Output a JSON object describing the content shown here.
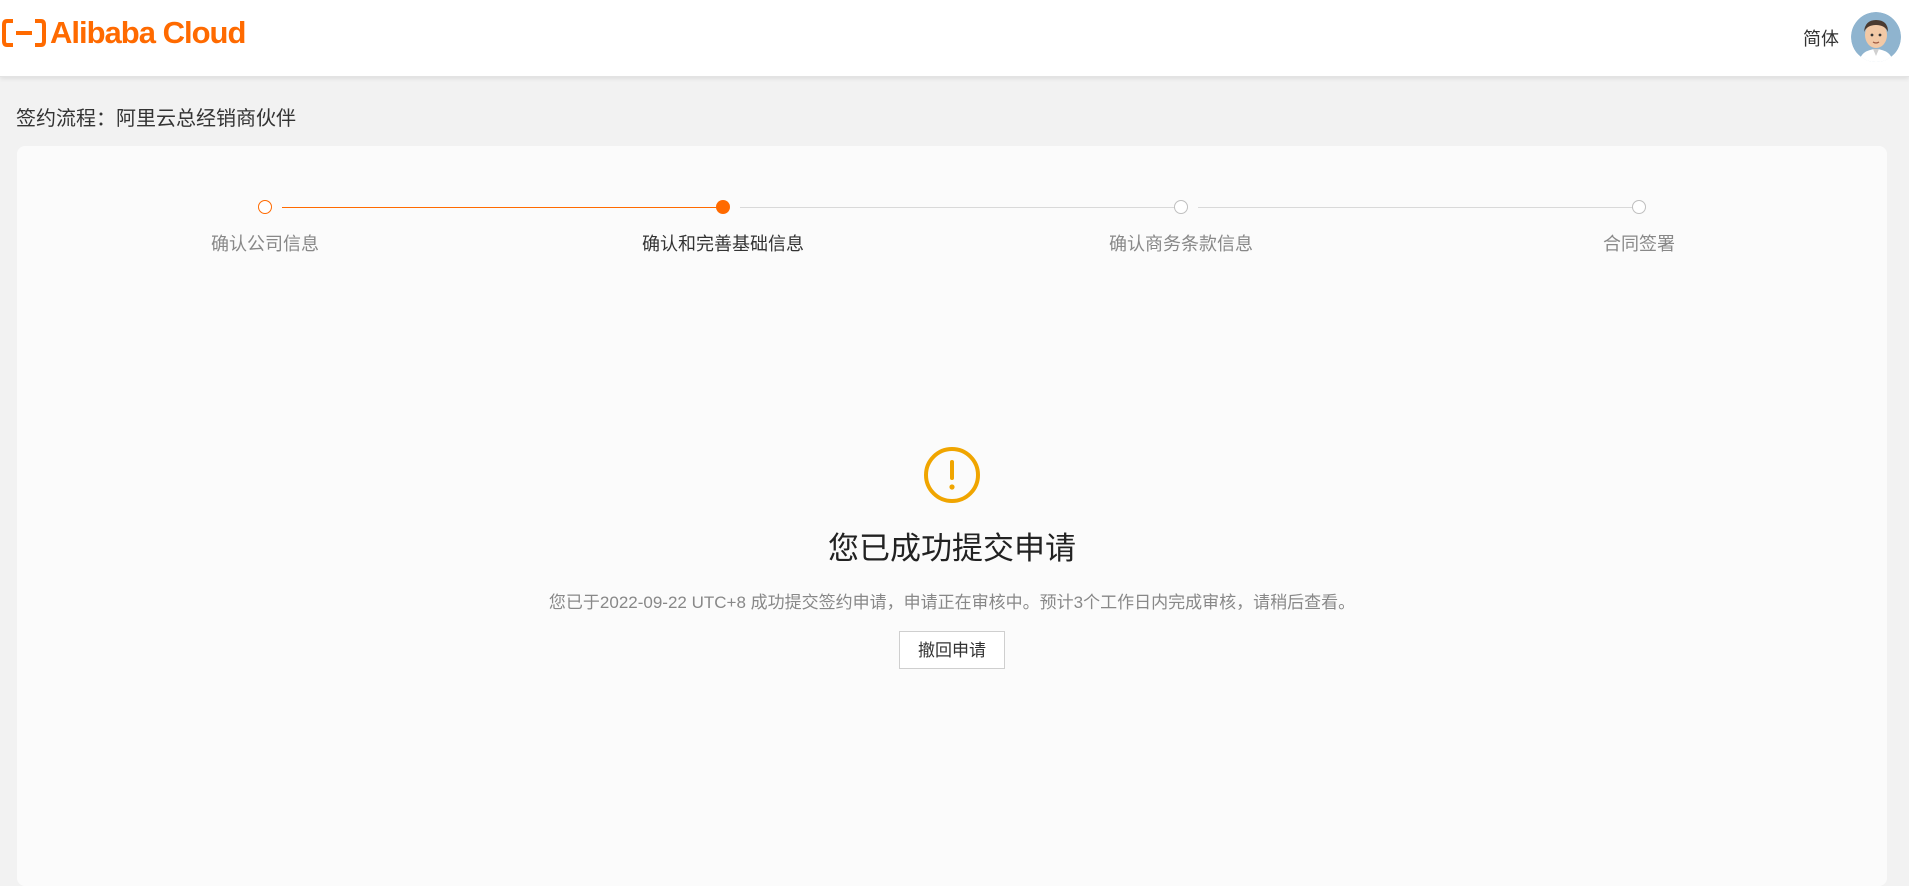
{
  "header": {
    "logo_text": "Alibaba Cloud",
    "language": "简体",
    "brand_color": "#ff6a00"
  },
  "breadcrumb": {
    "text": "签约流程：阿里云总经销商伙伴"
  },
  "steps": {
    "items": [
      {
        "label": "确认公司信息",
        "status": "done"
      },
      {
        "label": "确认和完善基础信息",
        "status": "current"
      },
      {
        "label": "确认商务条款信息",
        "status": "pending"
      },
      {
        "label": "合同签署",
        "status": "pending"
      }
    ]
  },
  "result": {
    "icon": "exclamation-circle-icon",
    "icon_color": "#f0a500",
    "title": "您已成功提交申请",
    "description": "您已于2022-09-22 UTC+8 成功提交签约申请，申请正在审核中。预计3个工作日内完成审核，请稍后查看。",
    "withdraw_label": "撤回申请"
  }
}
